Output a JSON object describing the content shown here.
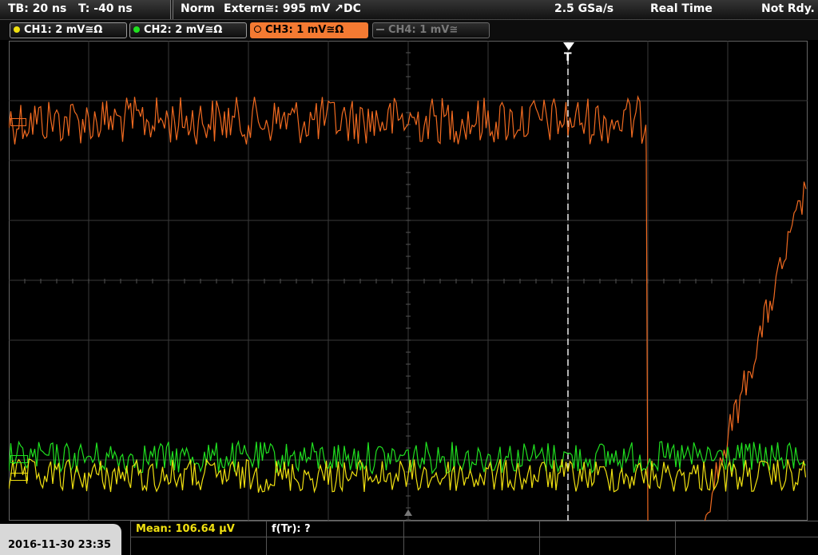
{
  "header": {
    "timebase": "TB: 20 ns",
    "trigger_offset": "T: -40 ns",
    "trigger_mode": "Norm",
    "trigger_source": "Extern≅: 995 mV ↗DC",
    "sample_rate": "2.5 GSa/s",
    "acq_mode": "Real Time",
    "status": "Not Rdy."
  },
  "channels": [
    {
      "label": "CH1: 2 mV≅Ω",
      "color": "#f0e010",
      "active": true
    },
    {
      "label": "CH2: 2 mV≅Ω",
      "color": "#20e020",
      "active": true
    },
    {
      "label": "CH3: 1 mV≅Ω",
      "color": "#f06a20",
      "active": true,
      "selected": true
    },
    {
      "label": "CH4: 1 mV≅",
      "color": "#888888",
      "active": false
    }
  ],
  "trigger_marker": "T",
  "waveforms": {
    "colors": {
      "ch1": "#f0e010",
      "ch2": "#20e020",
      "ch3": "#f06a20"
    }
  },
  "footer": {
    "datetime": "2016-11-30 23:35",
    "measurement_1": "Mean: 106.64 µV",
    "measurement_2": "f(Tr): ?"
  }
}
